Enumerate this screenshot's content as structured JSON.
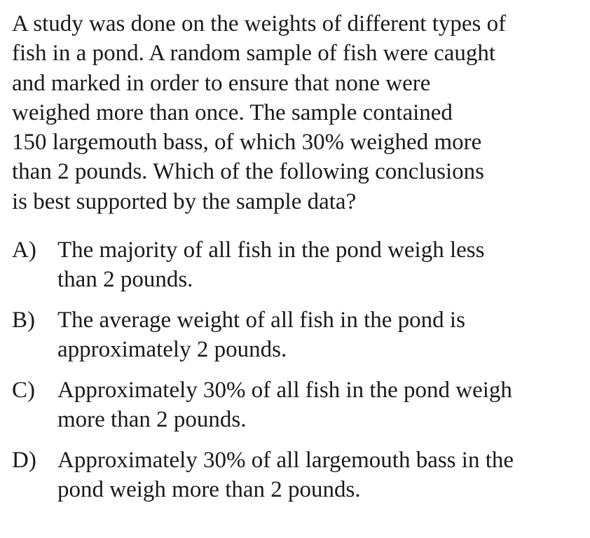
{
  "question": {
    "stem_lines": [
      "A study was done on the weights of different types of",
      "fish in a pond.  A random sample of fish were caught",
      "and marked in order to ensure that none were",
      "weighed more than once.  The sample contained",
      "150 largemouth bass, of which 30% weighed more",
      "than 2 pounds.  Which of the following conclusions",
      "is best supported by the sample data?"
    ],
    "choices": [
      {
        "letter": "A)",
        "lines": [
          "The majority of all fish in the pond weigh less",
          "than 2 pounds."
        ]
      },
      {
        "letter": "B)",
        "lines": [
          "The average weight of all fish in the pond is",
          "approximately 2 pounds."
        ]
      },
      {
        "letter": "C)",
        "lines": [
          "Approximately 30% of all fish in the pond weigh",
          "more than 2 pounds."
        ]
      },
      {
        "letter": "D)",
        "lines": [
          "Approximately 30% of all largemouth bass in the",
          "pond weigh more than 2 pounds."
        ]
      }
    ]
  }
}
